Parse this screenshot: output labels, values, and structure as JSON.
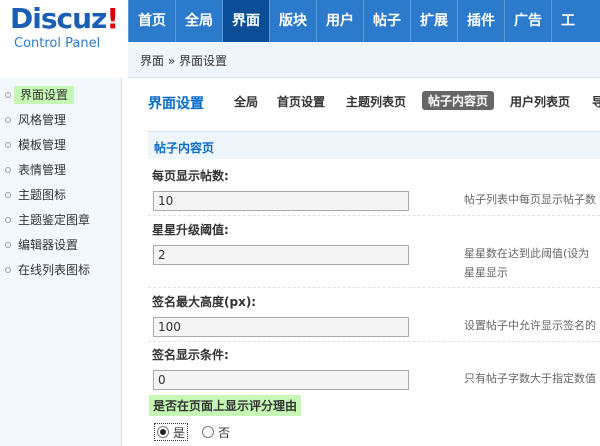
{
  "logo": {
    "text": "Discuz",
    "bang": "!",
    "sub": "Control Panel"
  },
  "nav": [
    "首页",
    "全局",
    "界面",
    "版块",
    "用户",
    "帖子",
    "扩展",
    "插件",
    "广告",
    "工"
  ],
  "nav_active_index": 2,
  "breadcrumb": "界面 » 界面设置",
  "sidebar": [
    "界面设置",
    "风格管理",
    "模板管理",
    "表情管理",
    "主题图标",
    "主题鉴定图章",
    "编辑器设置",
    "在线列表图标"
  ],
  "sidebar_active_index": 0,
  "tabs": {
    "title": "界面设置",
    "items": [
      "全局",
      "首页设置",
      "主题列表页",
      "帖子内容页",
      "用户列表页",
      "导"
    ],
    "active_index": 3
  },
  "section_title": "帖子内容页",
  "fields": [
    {
      "label": "每页显示帖数:",
      "value": "10",
      "hint": "帖子列表中每页显示帖子数"
    },
    {
      "label": "星星升级阈值:",
      "value": "2",
      "hint": "星星数在达到此阈值(设为",
      "hint2": "星星显示"
    },
    {
      "label": "签名最大高度(px):",
      "value": "100",
      "hint": "设置帖子中允许显示签名的"
    },
    {
      "label": "签名显示条件:",
      "value": "0",
      "hint": "只有帖子字数大于指定数值"
    }
  ],
  "rating_reason": {
    "label": "是否在页面上显示评分理由",
    "options": [
      "是",
      "否"
    ],
    "selected": "是"
  },
  "colors": {
    "header": "#2b7acb",
    "nav_active": "#0b4d96",
    "accent": "#0a6bc9",
    "highlight": "#c6f7b5"
  }
}
